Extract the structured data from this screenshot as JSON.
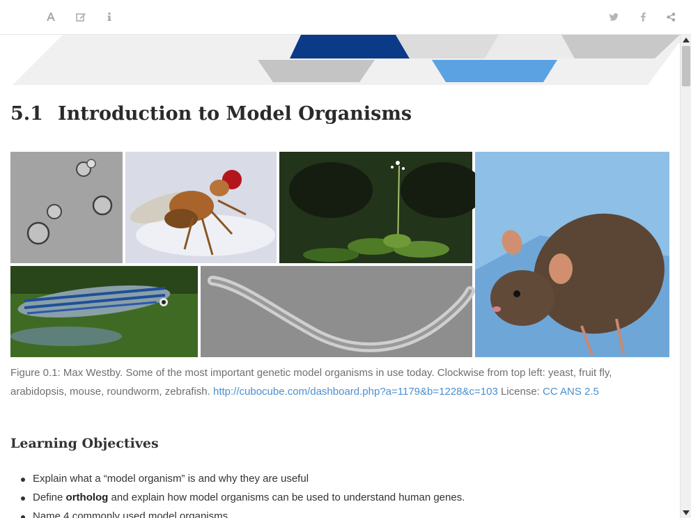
{
  "toolbar": {
    "left_icons": [
      "font-settings-icon",
      "edit-icon",
      "info-icon"
    ],
    "right_icons": [
      "twitter-icon",
      "facebook-icon",
      "share-icon"
    ]
  },
  "chapter": {
    "number": "5.1",
    "title": "Introduction to Model Organisms"
  },
  "figure": {
    "tiles": [
      "yeast",
      "fruit fly",
      "arabidopsis",
      "mouse",
      "zebrafish",
      "roundworm"
    ],
    "caption_text": "Figure 0.1: Max Westby. Some of the most important genetic model organisms in use today. Clockwise from top left: yeast, fruit fly, arabidopsis, mouse, roundworm, zebrafish.",
    "source_link": "http://cubocube.com/dashboard.php?a=1179&b=1228&c=103",
    "license_label": "License:",
    "license_link": "CC ANS 2.5"
  },
  "learning_objectives": {
    "title": "Learning Objectives",
    "items": [
      {
        "text": "Explain what a “model organism” is and why they are useful"
      },
      {
        "pre": "Define ",
        "bold": "ortholog",
        "post": " and explain how model organisms can be used to understand human genes."
      },
      {
        "text": "Name 4 commonly used model organisms"
      }
    ]
  },
  "colors": {
    "banner_dark_blue": "#0b3a88",
    "banner_light_blue": "#5aa2e2",
    "banner_gray": "#c8c8c8",
    "link": "#4a8fd0"
  }
}
